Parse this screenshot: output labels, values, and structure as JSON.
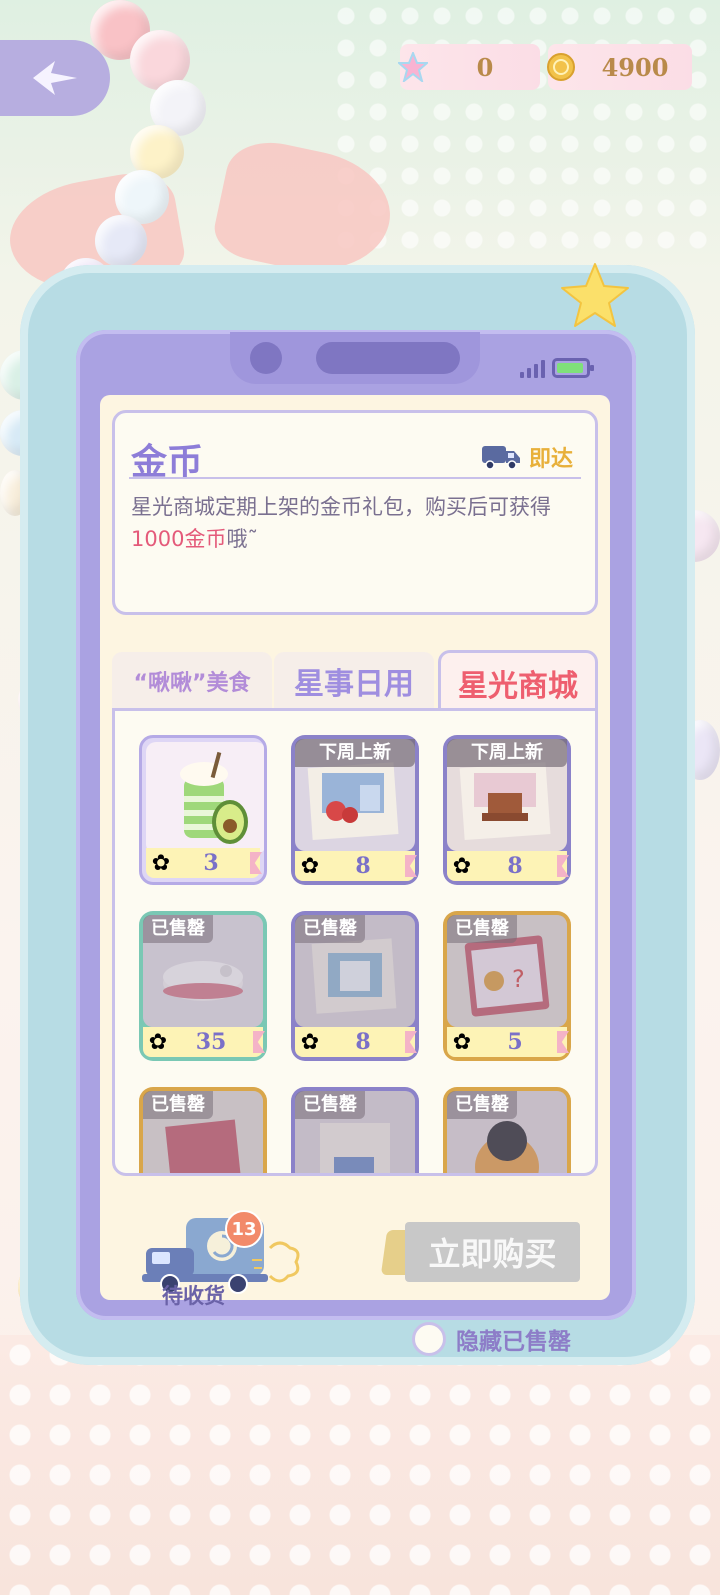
{
  "currency": {
    "stars": {
      "icon": "rainbow-star-icon",
      "value": "0"
    },
    "coins": {
      "icon": "gold-coin-icon",
      "value": "4900"
    }
  },
  "info_card": {
    "title": "金币",
    "delivery_label": "即达",
    "desc_before": "星光商城定期上架的金币礼包，购买后可获得",
    "desc_highlight": "1000金币",
    "desc_after": "哦˜"
  },
  "tabs": [
    {
      "label": "“啾啾”美食",
      "selected": false
    },
    {
      "label": "星事日用",
      "selected": false
    },
    {
      "label": "星光商城",
      "selected": true
    }
  ],
  "items": [
    {
      "name": "avocado-smoothie",
      "price": "3",
      "badge": "",
      "state": "selected"
    },
    {
      "name": "blue-bedroom-set",
      "price": "8",
      "badge": "下周上新",
      "state": "upcoming"
    },
    {
      "name": "pink-bedroom-set",
      "price": "8",
      "badge": "下周上新",
      "state": "upcoming"
    },
    {
      "name": "robot-vacuum",
      "price": "35",
      "badge": "已售罄",
      "state": "sold"
    },
    {
      "name": "blue-wall-decor",
      "price": "8",
      "badge": "已售罄",
      "state": "sold"
    },
    {
      "name": "sticker-book",
      "price": "5",
      "badge": "已售罄",
      "state": "sold"
    },
    {
      "name": "sticker-book-2",
      "price": "",
      "badge": "已售罄",
      "state": "sold"
    },
    {
      "name": "blue-decor-2",
      "price": "",
      "badge": "已售罄",
      "state": "sold"
    },
    {
      "name": "bear-item",
      "price": "",
      "badge": "已售罄",
      "state": "sold"
    }
  ],
  "bottom": {
    "pending_label": "待收货",
    "pending_count": "13",
    "buy_label": "立即购买",
    "hide_sold_label": "隐藏已售罄"
  },
  "colors": {
    "accent_purple": "#8d7dd8",
    "highlight_red": "#e45a7a",
    "tab_active": "#ee5f6f",
    "gold": "#e8b03a"
  }
}
